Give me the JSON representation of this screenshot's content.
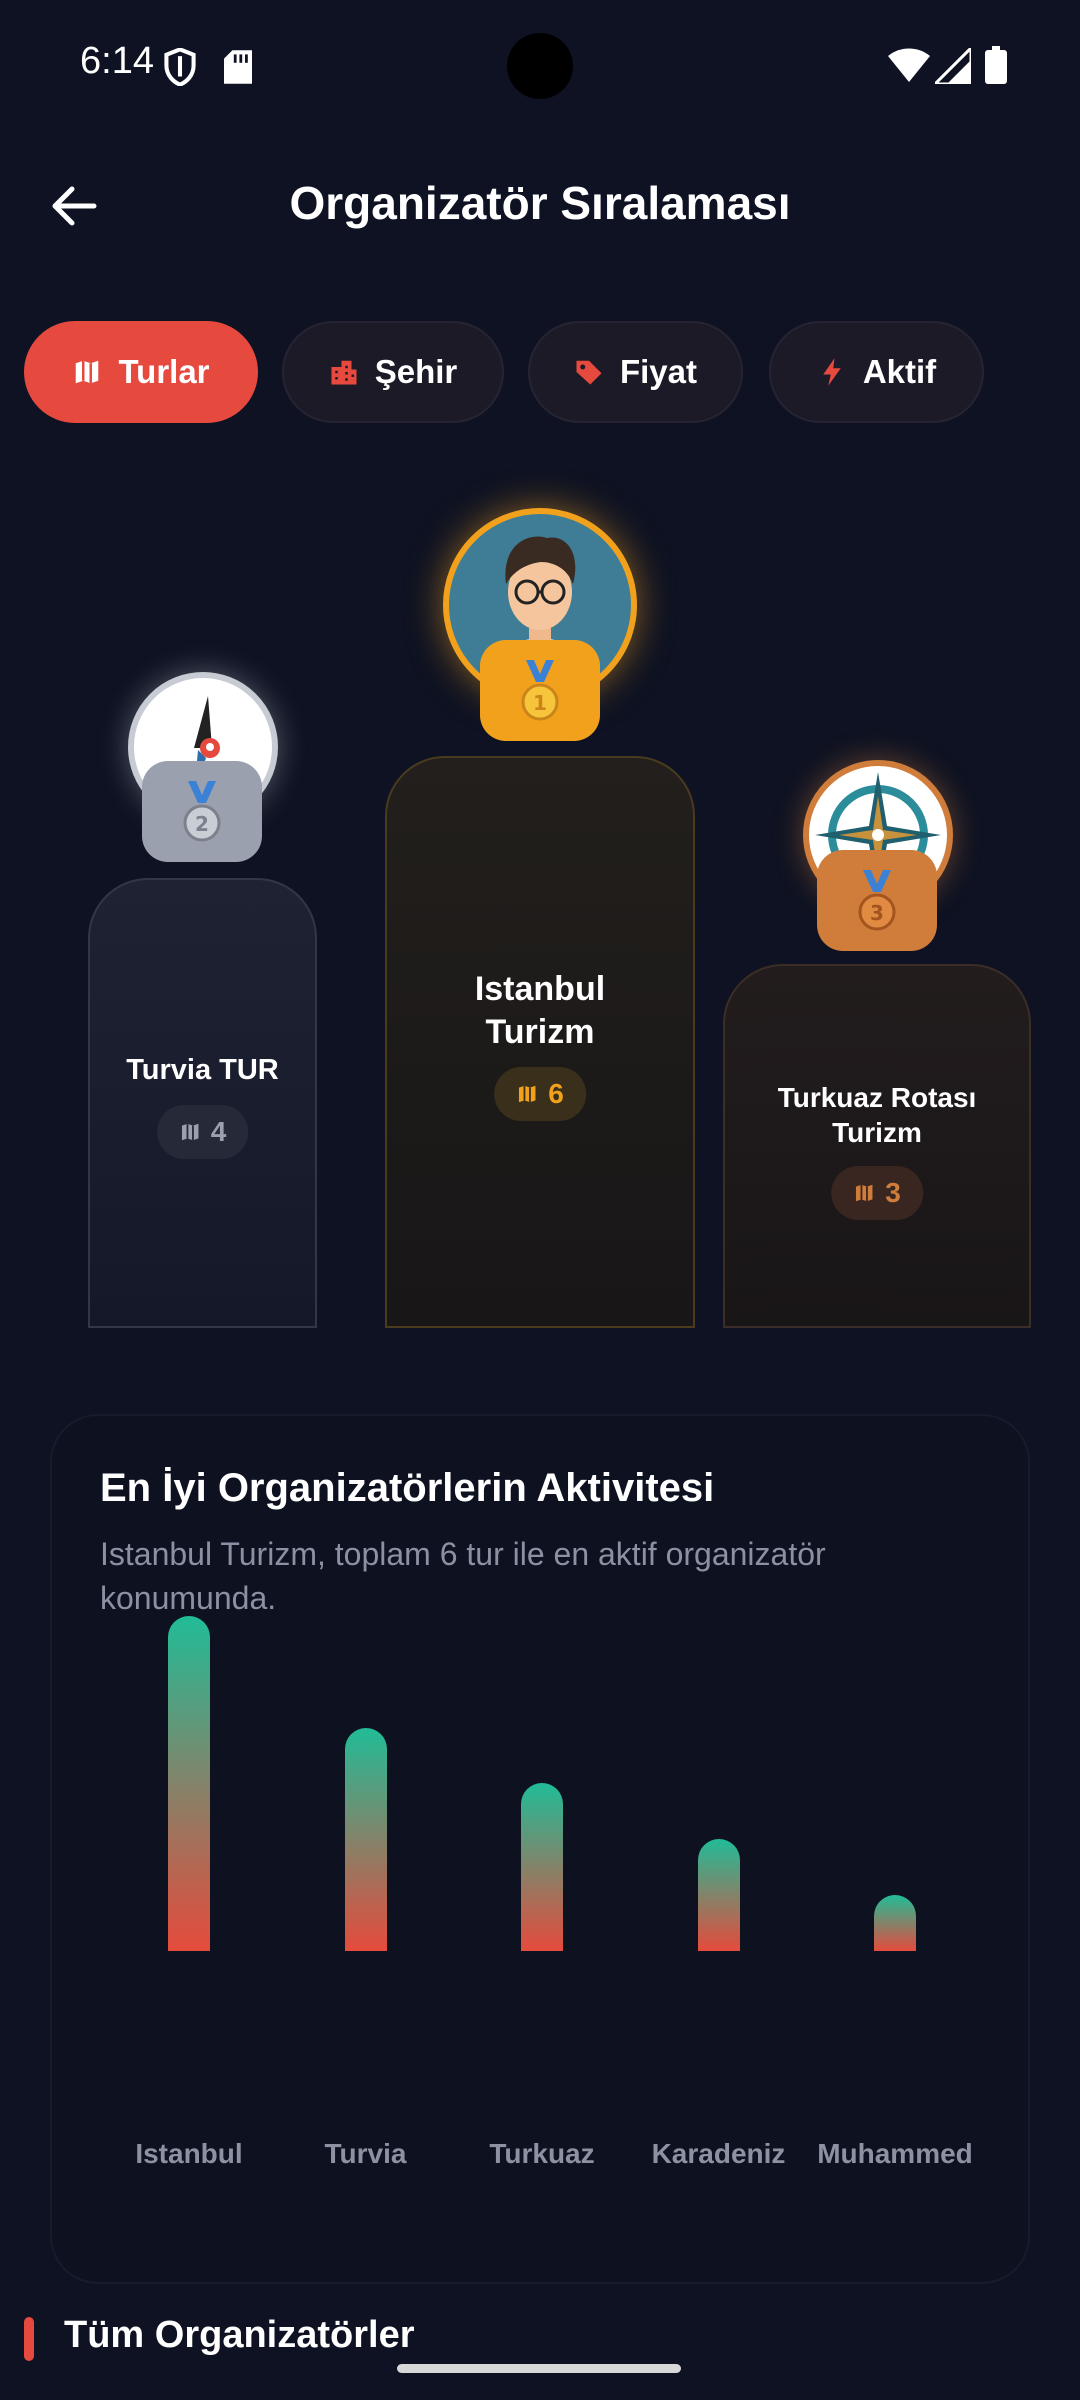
{
  "status_bar": {
    "time": "6:14"
  },
  "header": {
    "title": "Organizatör Sıralaması"
  },
  "filters": [
    {
      "label": "Turlar",
      "icon": "map-icon",
      "active": true
    },
    {
      "label": "Şehir",
      "icon": "city-icon",
      "active": false
    },
    {
      "label": "Fiyat",
      "icon": "tag-icon",
      "active": false
    },
    {
      "label": "Aktif",
      "icon": "bolt-icon",
      "active": false
    }
  ],
  "podium": {
    "first": {
      "rank": "1",
      "name": "Istanbul Turizm",
      "count": "6",
      "color": "#f2a11d"
    },
    "second": {
      "rank": "2",
      "name": "Turvia TUR",
      "count": "4",
      "color": "#9aa0ad"
    },
    "third": {
      "rank": "3",
      "name": "Turkuaz Rotası Turizm",
      "count": "3",
      "color": "#d07c3a"
    }
  },
  "activity": {
    "title": "En İyi Organizatörlerin Aktivitesi",
    "subtitle": "Istanbul Turizm, toplam 6 tur ile en aktif organizatör konumunda."
  },
  "chart_data": {
    "type": "bar",
    "categories": [
      "Istanbul",
      "Turvia",
      "Turkuaz",
      "Karadeniz",
      "Muhammed"
    ],
    "values": [
      6,
      4,
      3,
      2,
      1
    ],
    "ylim": [
      0,
      6
    ],
    "colors": {
      "top": "#21bc97",
      "bottom": "#e54b3c"
    }
  },
  "section": {
    "title": "Tüm Organizatörler"
  },
  "colors": {
    "accent": "#e64a3f",
    "background": "#0e1222"
  }
}
